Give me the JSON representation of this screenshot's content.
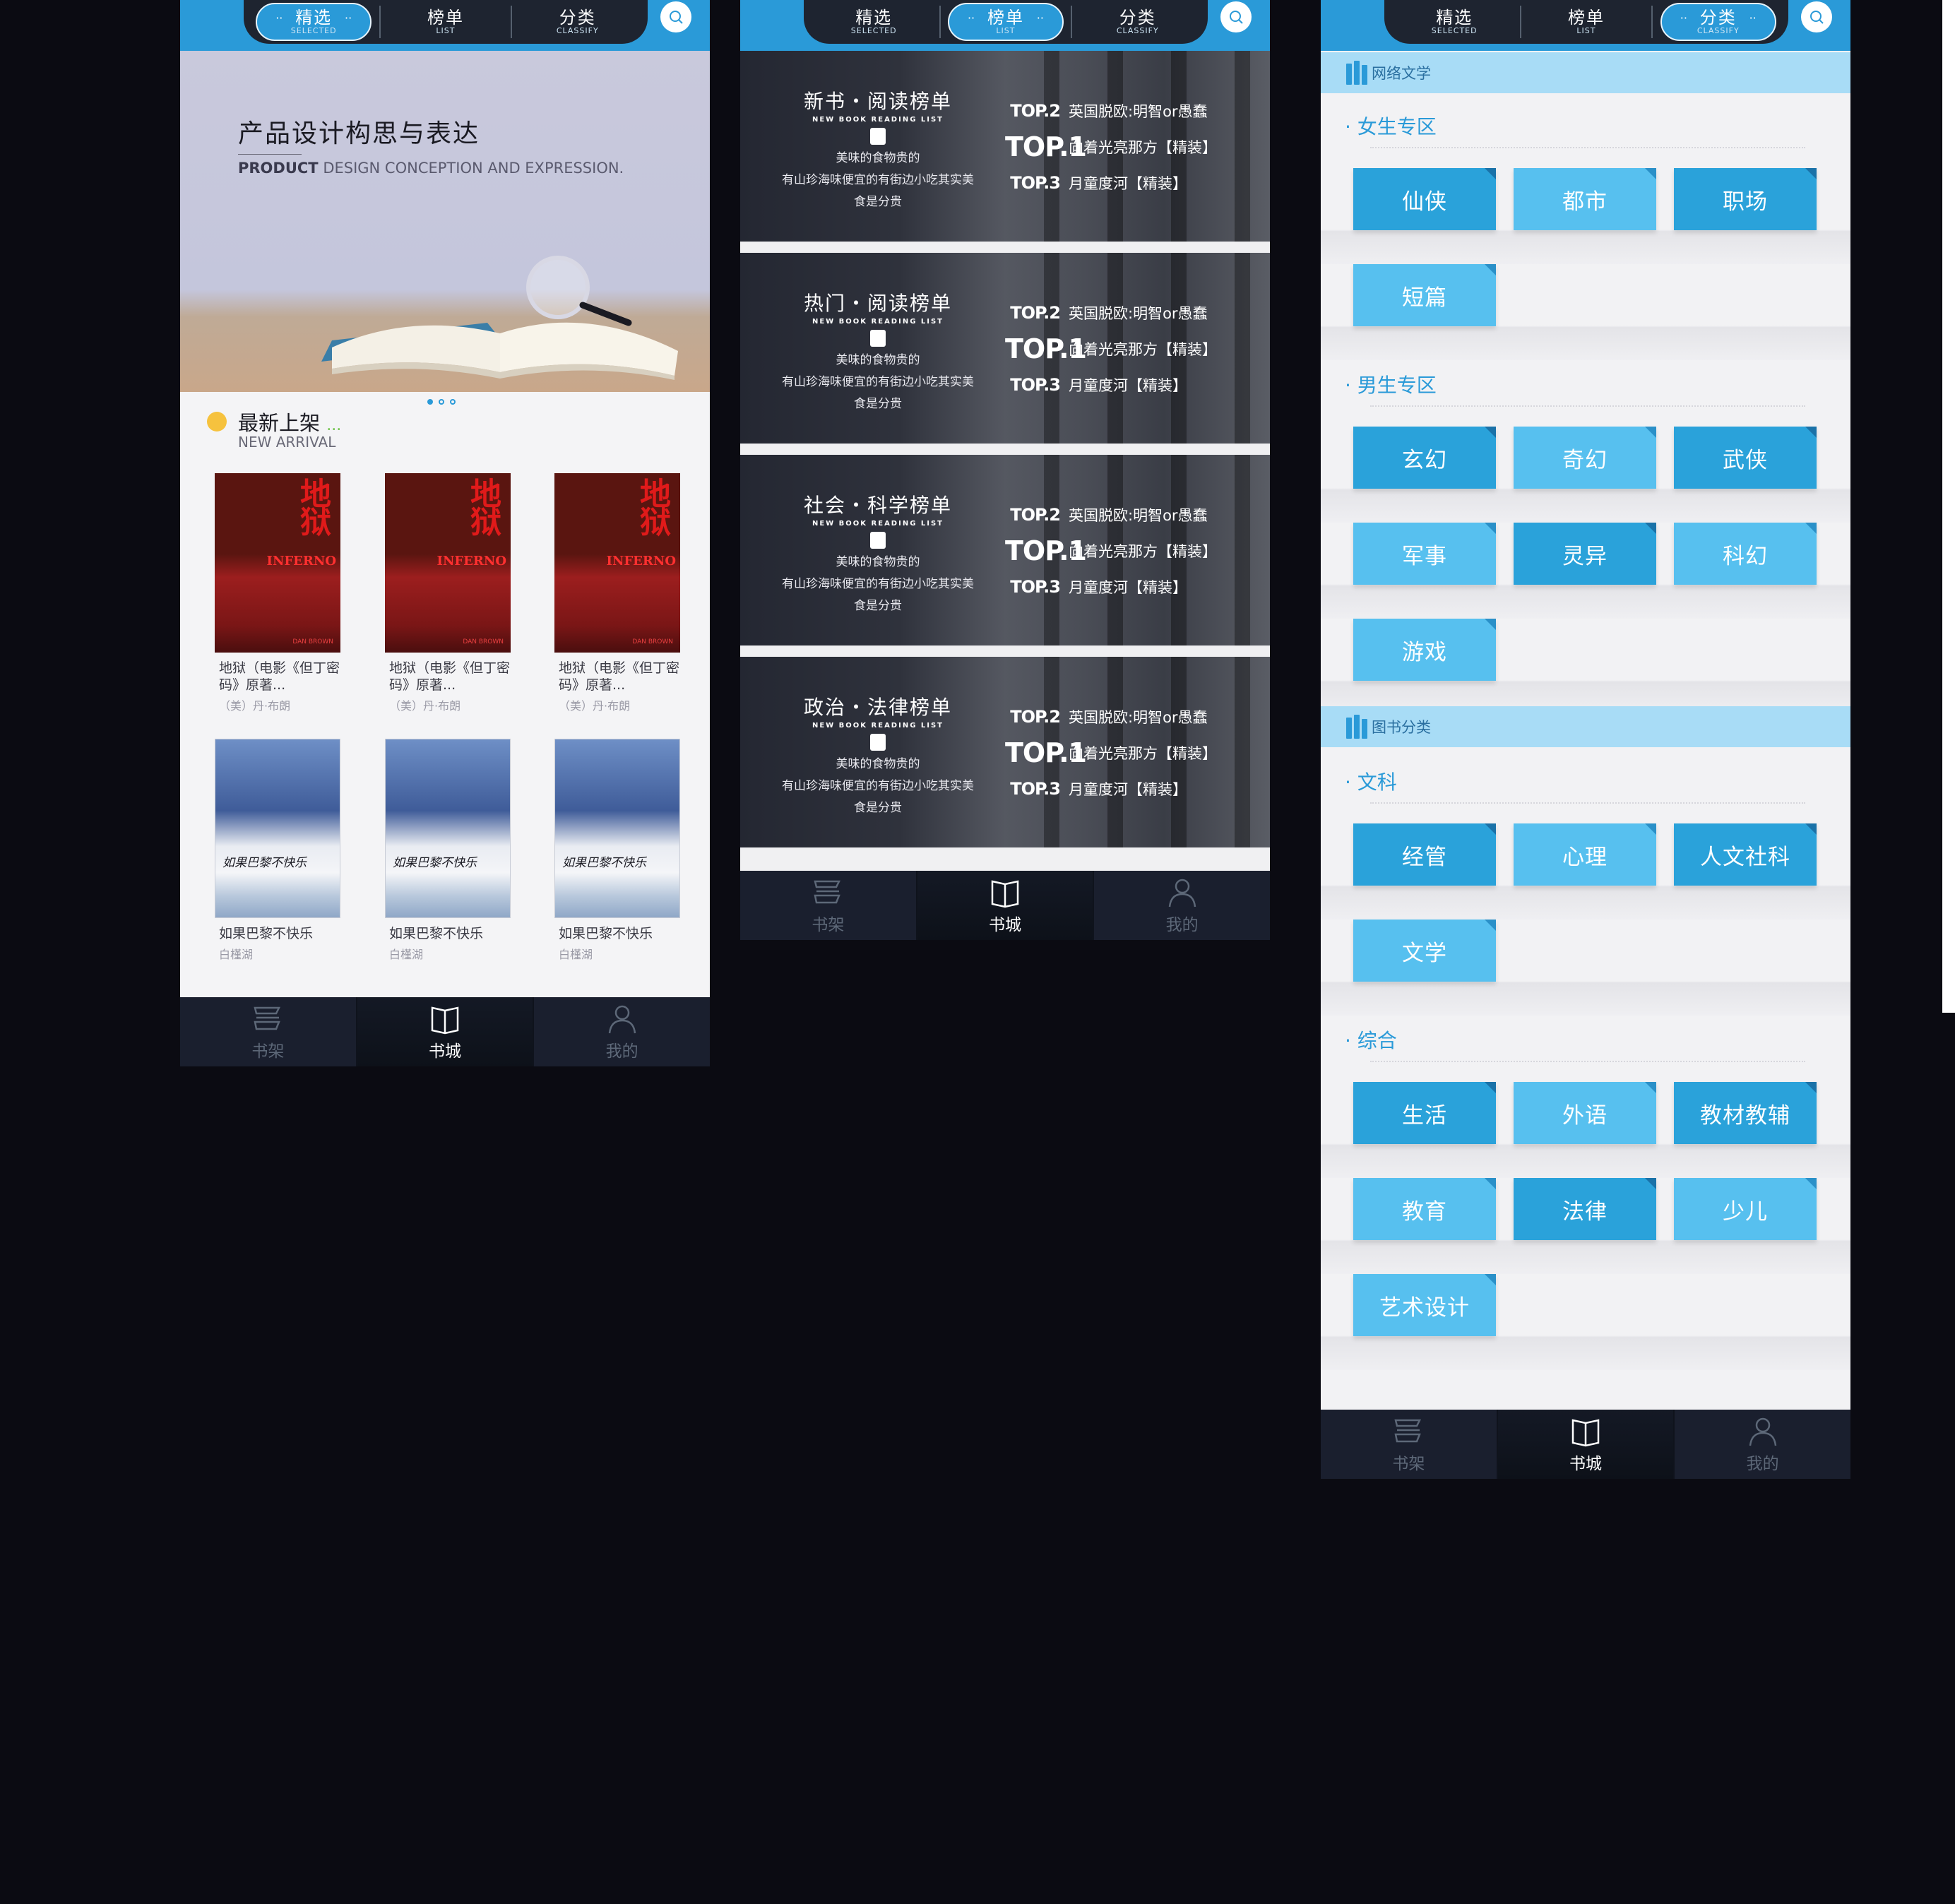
{
  "colors": {
    "accent": "#2a9ad8",
    "tabbar": "#1a1f2e",
    "chip_dark": "#2aa2da",
    "chip_light": "#57c0ef",
    "background": "#0b0b12"
  },
  "nav": {
    "tabs": [
      {
        "zh": "精选",
        "en": "SELECTED"
      },
      {
        "zh": "榜单",
        "en": "LIST"
      },
      {
        "zh": "分类",
        "en": "CLASSIFY"
      }
    ],
    "dots": "··",
    "search_icon": "search-icon"
  },
  "tabbar": {
    "shelf": "书架",
    "store": "书城",
    "mine": "我的"
  },
  "screen1": {
    "banner": {
      "title": "产品设计构思与表达",
      "sub_bold": "PRODUCT",
      "sub_rest": " DESIGN CONCEPTION AND EXPRESSION."
    },
    "section": {
      "title": "最新上架",
      "ellipsis": "...",
      "sub": "NEW ARRIVAL"
    },
    "inferno_cover": {
      "title": "地狱",
      "en": "INFERNO",
      "author_en": "DAN BROWN"
    },
    "paris_cover": {
      "text": "如果巴黎不快乐"
    },
    "books": [
      {
        "title": "地狱（电影《但丁密码》原著...",
        "author": "（美）丹·布朗",
        "cover": "inferno"
      },
      {
        "title": "地狱（电影《但丁密码》原著...",
        "author": "（美）丹·布朗",
        "cover": "inferno"
      },
      {
        "title": "地狱（电影《但丁密码》原著...",
        "author": "（美）丹·布朗",
        "cover": "inferno"
      },
      {
        "title": "如果巴黎不快乐",
        "author": "白槿湖",
        "cover": "paris"
      },
      {
        "title": "如果巴黎不快乐",
        "author": "白槿湖",
        "cover": "paris"
      },
      {
        "title": "如果巴黎不快乐",
        "author": "白槿湖",
        "cover": "paris"
      }
    ]
  },
  "screen2": {
    "rank_sub": "NEW BOOK READING LIST",
    "desc": [
      "美味的食物贵的",
      "有山珍海味便宜的有街边小吃其实美",
      "食是分贵"
    ],
    "tops": [
      {
        "tag": "TOP.2",
        "title": "英国脱欧:明智or愚蠢"
      },
      {
        "tag": "TOP.1",
        "title": "向着光亮那方【精装】"
      },
      {
        "tag": "TOP.3",
        "title": "月童度河【精装】"
      }
    ],
    "lists": [
      "新书・阅读榜单",
      "热门・阅读榜单",
      "社会・科学榜单",
      "政治・法律榜单"
    ]
  },
  "screen3": {
    "cat1": "网络文学",
    "zones1": [
      {
        "name": "· 女生专区",
        "chips": [
          "仙侠",
          "都市",
          "职场",
          "短篇"
        ]
      },
      {
        "name": "· 男生专区",
        "chips": [
          "玄幻",
          "奇幻",
          "武侠",
          "军事",
          "灵异",
          "科幻",
          "游戏"
        ]
      }
    ],
    "cat2": "图书分类",
    "zones2": [
      {
        "name": "· 文科",
        "chips": [
          "经管",
          "心理",
          "人文社科",
          "文学"
        ]
      },
      {
        "name": "· 综合",
        "chips": [
          "生活",
          "外语",
          "教材教辅",
          "教育",
          "法律",
          "少儿",
          "艺术设计"
        ]
      }
    ]
  }
}
